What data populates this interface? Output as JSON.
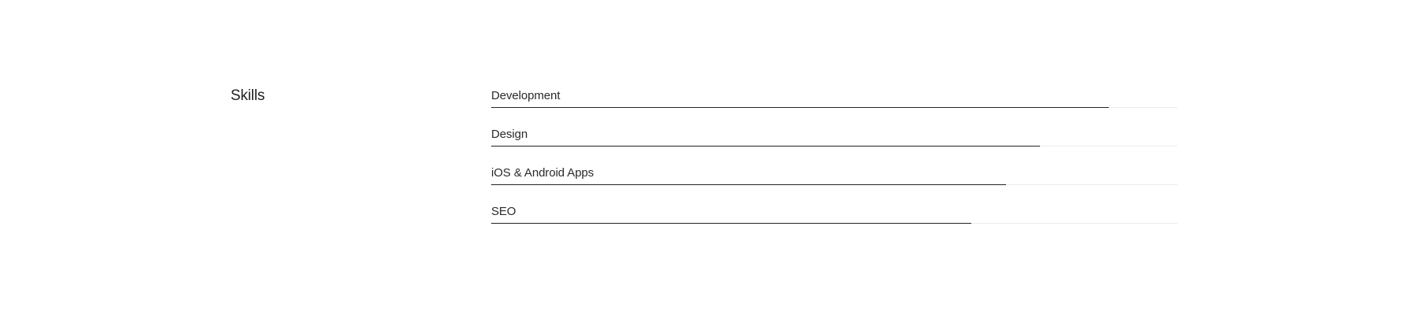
{
  "skills": {
    "title": "Skills",
    "items": [
      {
        "label": "Development",
        "level_percent": 90
      },
      {
        "label": "Design",
        "level_percent": 80
      },
      {
        "label": "iOS & Android Apps",
        "level_percent": 75
      },
      {
        "label": "SEO",
        "level_percent": 70
      }
    ]
  },
  "colors": {
    "text": "#222222",
    "bar_fill": "#222222",
    "bar_track": "#ececec",
    "background": "#ffffff"
  }
}
